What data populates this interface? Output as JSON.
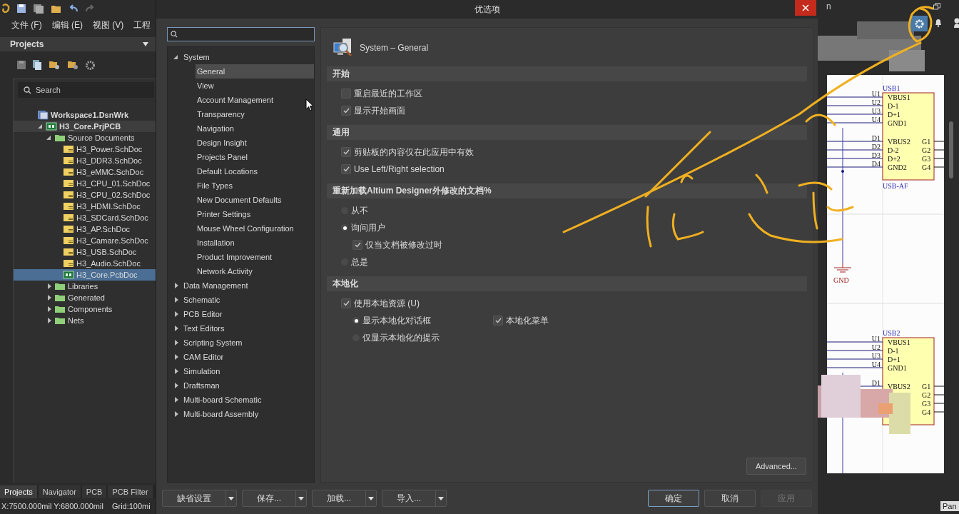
{
  "main_window": {
    "menu": [
      {
        "label": "文件 (F)"
      },
      {
        "label": "编辑 (E)"
      },
      {
        "label": "视图 (V)"
      },
      {
        "label": "工程"
      }
    ],
    "projects_panel": {
      "title": "Projects",
      "search": {
        "placeholder": "Search"
      },
      "tree": [
        {
          "label": "Workspace1.DsnWrk",
          "kind": "workspace",
          "selected": false,
          "highlighted": false,
          "children": [
            {
              "label": "H3_Core.PrjPCB",
              "kind": "project",
              "expanded": true,
              "selected": false,
              "highlighted": true,
              "children": [
                {
                  "label": "Source Documents",
                  "kind": "folder",
                  "expanded": true,
                  "selected": false,
                  "highlighted": false,
                  "children": [
                    {
                      "label": "H3_Power.SchDoc",
                      "kind": "schdoc",
                      "selected": false,
                      "highlighted": false
                    },
                    {
                      "label": "H3_DDR3.SchDoc",
                      "kind": "schdoc",
                      "selected": false,
                      "highlighted": false
                    },
                    {
                      "label": "H3_eMMC.SchDoc",
                      "kind": "schdoc",
                      "selected": false,
                      "highlighted": false
                    },
                    {
                      "label": "H3_CPU_01.SchDoc",
                      "kind": "schdoc",
                      "selected": false,
                      "highlighted": false
                    },
                    {
                      "label": "H3_CPU_02.SchDoc",
                      "kind": "schdoc",
                      "selected": false,
                      "highlighted": false
                    },
                    {
                      "label": "H3_HDMI.SchDoc",
                      "kind": "schdoc",
                      "selected": false,
                      "highlighted": false
                    },
                    {
                      "label": "H3_SDCard.SchDoc",
                      "kind": "schdoc",
                      "selected": false,
                      "highlighted": false
                    },
                    {
                      "label": "H3_AP.SchDoc",
                      "kind": "schdoc",
                      "selected": false,
                      "highlighted": false
                    },
                    {
                      "label": "H3_Camare.SchDoc",
                      "kind": "schdoc",
                      "selected": false,
                      "highlighted": false
                    },
                    {
                      "label": "H3_USB.SchDoc",
                      "kind": "schdoc",
                      "selected": false,
                      "highlighted": false
                    },
                    {
                      "label": "H3_Audio.SchDoc",
                      "kind": "schdoc",
                      "selected": false,
                      "highlighted": false
                    },
                    {
                      "label": "H3_Core.PcbDoc",
                      "kind": "pcbdoc",
                      "selected": true,
                      "highlighted": false
                    }
                  ]
                },
                {
                  "label": "Libraries",
                  "kind": "folder",
                  "expanded": false,
                  "selected": false,
                  "highlighted": false
                },
                {
                  "label": "Generated",
                  "kind": "folder",
                  "expanded": false,
                  "selected": false,
                  "highlighted": false
                },
                {
                  "label": "Components",
                  "kind": "folder",
                  "expanded": false,
                  "selected": false,
                  "highlighted": false
                },
                {
                  "label": "Nets",
                  "kind": "folder",
                  "expanded": false,
                  "selected": false,
                  "highlighted": false
                }
              ]
            }
          ]
        }
      ],
      "tabs": [
        {
          "label": "Projects",
          "selected": true
        },
        {
          "label": "Navigator",
          "selected": false
        },
        {
          "label": "PCB",
          "selected": false
        },
        {
          "label": "PCB Filter",
          "selected": false
        }
      ]
    },
    "status_bar": {
      "coordinates": "X:7500.000mil Y:6800.000mil",
      "grid": "Grid:100mi"
    },
    "title_fragment": "n",
    "schematic": {
      "parts": [
        {
          "ref": "USB1",
          "value": "USB-AF",
          "nets": [
            "U1",
            "U2",
            "U3",
            "U4",
            "D1",
            "D2",
            "D3",
            "D4"
          ],
          "pins": [
            "VBUS1",
            "D-1",
            "D+1",
            "GND1",
            "VBUS2",
            "D-2",
            "D+2",
            "GND2"
          ],
          "right_pins": [
            "G1",
            "G2",
            "G3",
            "G4"
          ]
        },
        {
          "ref": "USB2",
          "nets": [
            "U1",
            "U2",
            "U3",
            "U4",
            "D1"
          ],
          "pins": [
            "VBUS1",
            "D-1",
            "D+1",
            "GND1",
            "VBUS2"
          ],
          "right_pins": [
            "G1",
            "G2",
            "G3",
            "G4"
          ]
        }
      ],
      "ground_label": "GND"
    },
    "panels_button": "Pan"
  },
  "dialog": {
    "title": "优选项",
    "nav": [
      {
        "label": "System",
        "expanded": true,
        "selected": false,
        "children": [
          {
            "label": "General",
            "selected": true
          },
          {
            "label": "View",
            "selected": false
          },
          {
            "label": "Account Management",
            "selected": false
          },
          {
            "label": "Transparency",
            "selected": false
          },
          {
            "label": "Navigation",
            "selected": false
          },
          {
            "label": "Design Insight",
            "selected": false
          },
          {
            "label": "Projects Panel",
            "selected": false
          },
          {
            "label": "Default Locations",
            "selected": false
          },
          {
            "label": "File Types",
            "selected": false
          },
          {
            "label": "New Document Defaults",
            "selected": false
          },
          {
            "label": "Printer Settings",
            "selected": false
          },
          {
            "label": "Mouse Wheel Configuration",
            "selected": false
          },
          {
            "label": "Installation",
            "selected": false
          },
          {
            "label": "Product Improvement",
            "selected": false
          },
          {
            "label": "Network Activity",
            "selected": false
          }
        ]
      },
      {
        "label": "Data Management",
        "expanded": false,
        "selected": false
      },
      {
        "label": "Schematic",
        "expanded": false,
        "selected": false
      },
      {
        "label": "PCB Editor",
        "expanded": false,
        "selected": false
      },
      {
        "label": "Text Editors",
        "expanded": false,
        "selected": false
      },
      {
        "label": "Scripting System",
        "expanded": false,
        "selected": false
      },
      {
        "label": "CAM Editor",
        "expanded": false,
        "selected": false
      },
      {
        "label": "Simulation",
        "expanded": false,
        "selected": false
      },
      {
        "label": "Draftsman",
        "expanded": false,
        "selected": false
      },
      {
        "label": "Multi-board Schematic",
        "expanded": false,
        "selected": false
      },
      {
        "label": "Multi-board Assembly",
        "expanded": false,
        "selected": false
      }
    ],
    "page_title": "System – General",
    "sections": [
      {
        "title": "开始",
        "options": [
          {
            "kind": "checkbox",
            "label": "重启最近的工作区",
            "checked": false
          },
          {
            "kind": "checkbox",
            "label": "显示开始画面",
            "checked": true
          }
        ]
      },
      {
        "title": "通用",
        "options": [
          {
            "kind": "checkbox",
            "label": "剪贴板的内容仅在此应用中有效",
            "checked": true
          },
          {
            "kind": "checkbox",
            "label": "Use Left/Right selection",
            "checked": true
          }
        ]
      },
      {
        "title": "重新加载Altium Designer外修改的文档%",
        "options": [
          {
            "kind": "radio",
            "label": "从不",
            "selected": false
          },
          {
            "kind": "radio",
            "label": "询问用户",
            "selected": true,
            "children": [
              {
                "kind": "checkbox",
                "label": "仅当文档被修改过时",
                "checked": true
              }
            ]
          },
          {
            "kind": "radio",
            "label": "总是",
            "selected": false
          }
        ]
      },
      {
        "title": "本地化",
        "options": [
          {
            "kind": "checkbox",
            "label": "使用本地资源 (U)",
            "checked": true,
            "children": [
              {
                "kind": "radio",
                "label": "显示本地化对话框",
                "selected": true,
                "side": {
                  "kind": "checkbox",
                  "label": "本地化菜单",
                  "checked": true
                }
              },
              {
                "kind": "radio",
                "label": "仅显示本地化的提示",
                "selected": false
              }
            ]
          }
        ]
      }
    ],
    "advanced_button": "Advanced...",
    "footer_left": [
      {
        "label": "缺省设置"
      },
      {
        "label": "保存..."
      },
      {
        "label": "加载..."
      },
      {
        "label": "导入..."
      }
    ],
    "footer_right": [
      {
        "label": "确定",
        "kind": "default",
        "disabled": false
      },
      {
        "label": "取消",
        "kind": "normal",
        "disabled": false
      },
      {
        "label": "应用",
        "kind": "normal",
        "disabled": true
      }
    ]
  }
}
